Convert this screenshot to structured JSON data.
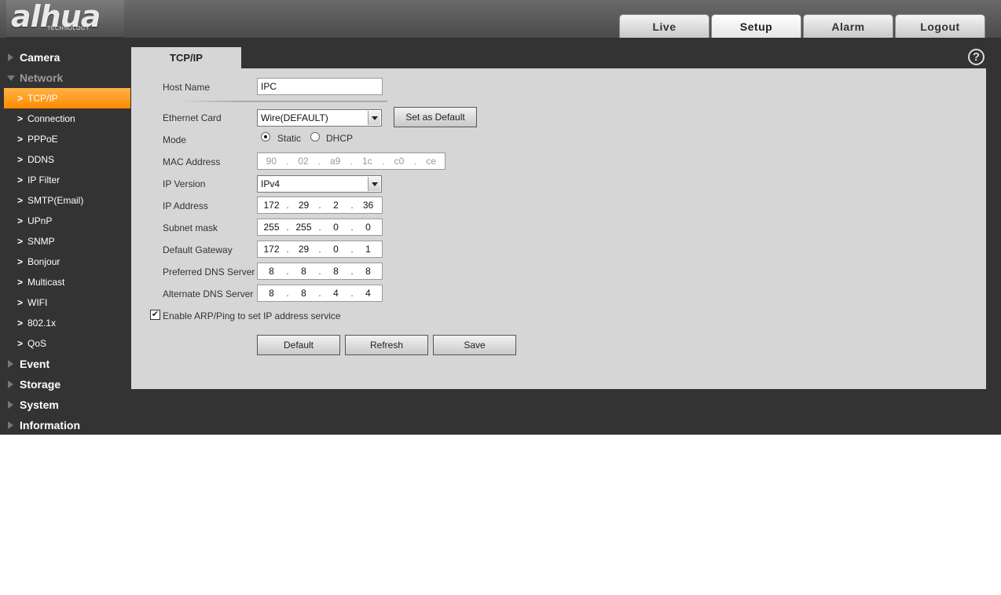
{
  "logo": {
    "word": "alhua",
    "sub": "TECHNOLOGY"
  },
  "tabs": [
    "Live",
    "Setup",
    "Alarm",
    "Logout"
  ],
  "sidebar": {
    "camera": "Camera",
    "network": "Network",
    "network_items": [
      "TCP/IP",
      "Connection",
      "PPPoE",
      "DDNS",
      "IP Filter",
      "SMTP(Email)",
      "UPnP",
      "SNMP",
      "Bonjour",
      "Multicast",
      "WIFI",
      "802.1x",
      "QoS"
    ],
    "event": "Event",
    "storage": "Storage",
    "system": "System",
    "information": "Information"
  },
  "content": {
    "tab_label": "TCP/IP",
    "help_symbol": "?"
  },
  "form": {
    "host_name_label": "Host Name",
    "host_name_value": "IPC",
    "ethernet_card_label": "Ethernet Card",
    "ethernet_card_value": "Wire(DEFAULT)",
    "set_default_label": "Set as Default",
    "mode_label": "Mode",
    "mode_static": "Static",
    "mode_dhcp": "DHCP",
    "mac_label": "MAC Address",
    "mac": [
      "90",
      "02",
      "a9",
      "1c",
      "c0",
      "ce"
    ],
    "ip_version_label": "IP Version",
    "ip_version_value": "IPv4",
    "ip_address_label": "IP Address",
    "ip_address": [
      "172",
      "29",
      "2",
      "36"
    ],
    "subnet_label": "Subnet mask",
    "subnet": [
      "255",
      "255",
      "0",
      "0"
    ],
    "gateway_label": "Default Gateway",
    "gateway": [
      "172",
      "29",
      "0",
      "1"
    ],
    "pref_dns_label": "Preferred DNS Server",
    "pref_dns": [
      "8",
      "8",
      "8",
      "8"
    ],
    "alt_dns_label": "Alternate DNS Server",
    "alt_dns": [
      "8",
      "8",
      "4",
      "4"
    ],
    "arp_label": "Enable ARP/Ping to set IP address service",
    "check_mark": "✔",
    "dot": ".",
    "default_btn": "Default",
    "refresh_btn": "Refresh",
    "save_btn": "Save"
  },
  "colors": {
    "accent": "#ff9a1f",
    "panel": "#d6d6d6",
    "dark": "#333333"
  }
}
